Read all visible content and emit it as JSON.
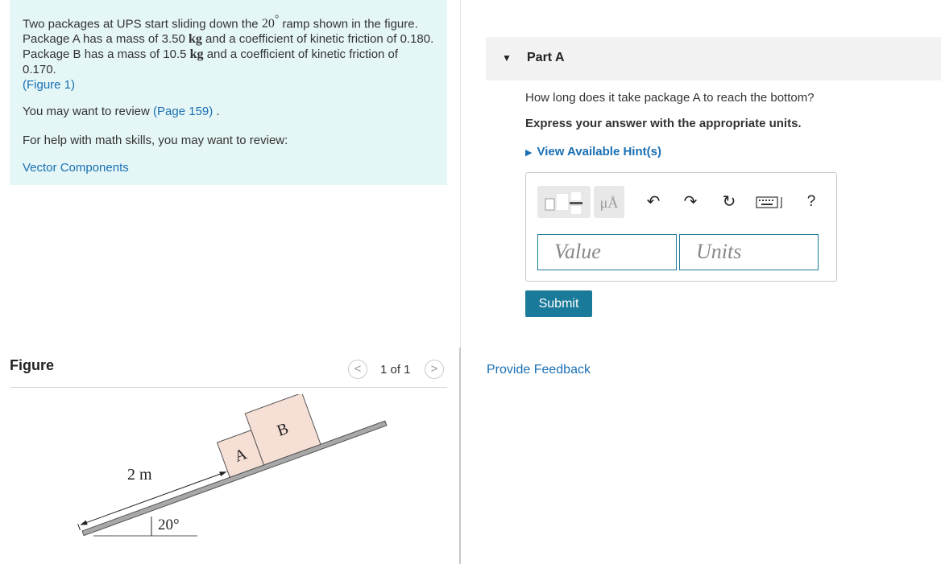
{
  "problem": {
    "text_a": "Two packages at UPS start sliding down the ",
    "angle": "20",
    "degree_symbol": "°",
    "text_b": " ramp shown in the figure. Package A has a mass of 3.50 ",
    "unit_kg_1": "kg",
    "text_c": " and a coefficient of kinetic friction of 0.180. Package B has a mass of 10.5 ",
    "unit_kg_2": "kg",
    "text_d": " and a coefficient of kinetic friction of 0.170.",
    "figure_link": "(Figure 1)",
    "review_prefix": "You may want to review ",
    "review_link": "(Page 159)",
    "review_suffix": " .",
    "math_help": "For help with math skills, you may want to review:",
    "vector_link": "Vector Components"
  },
  "figure": {
    "title": "Figure",
    "pager": "1 of 1",
    "prev_glyph": "<",
    "next_glyph": ">",
    "label_a": "A",
    "label_b": "B",
    "distance_label": "2 m",
    "angle_label": "20°"
  },
  "part": {
    "caret": "▼",
    "title": "Part A",
    "question": "How long does it take package A to reach the bottom?",
    "instruction": "Express your answer with the appropriate units.",
    "hints_caret": "▶",
    "hints": "View Available Hint(s)"
  },
  "answer": {
    "value_placeholder": "Value",
    "units_placeholder": "Units",
    "units_button": "μÅ",
    "undo_glyph": "↶",
    "redo_glyph": "↷",
    "reset_glyph": "↻",
    "help_glyph": "?",
    "submit": "Submit"
  },
  "feedback": "Provide Feedback",
  "colors": {
    "accent": "#1a7a99",
    "link": "#1a6fb3",
    "problem_bg": "#e5f6f6"
  }
}
